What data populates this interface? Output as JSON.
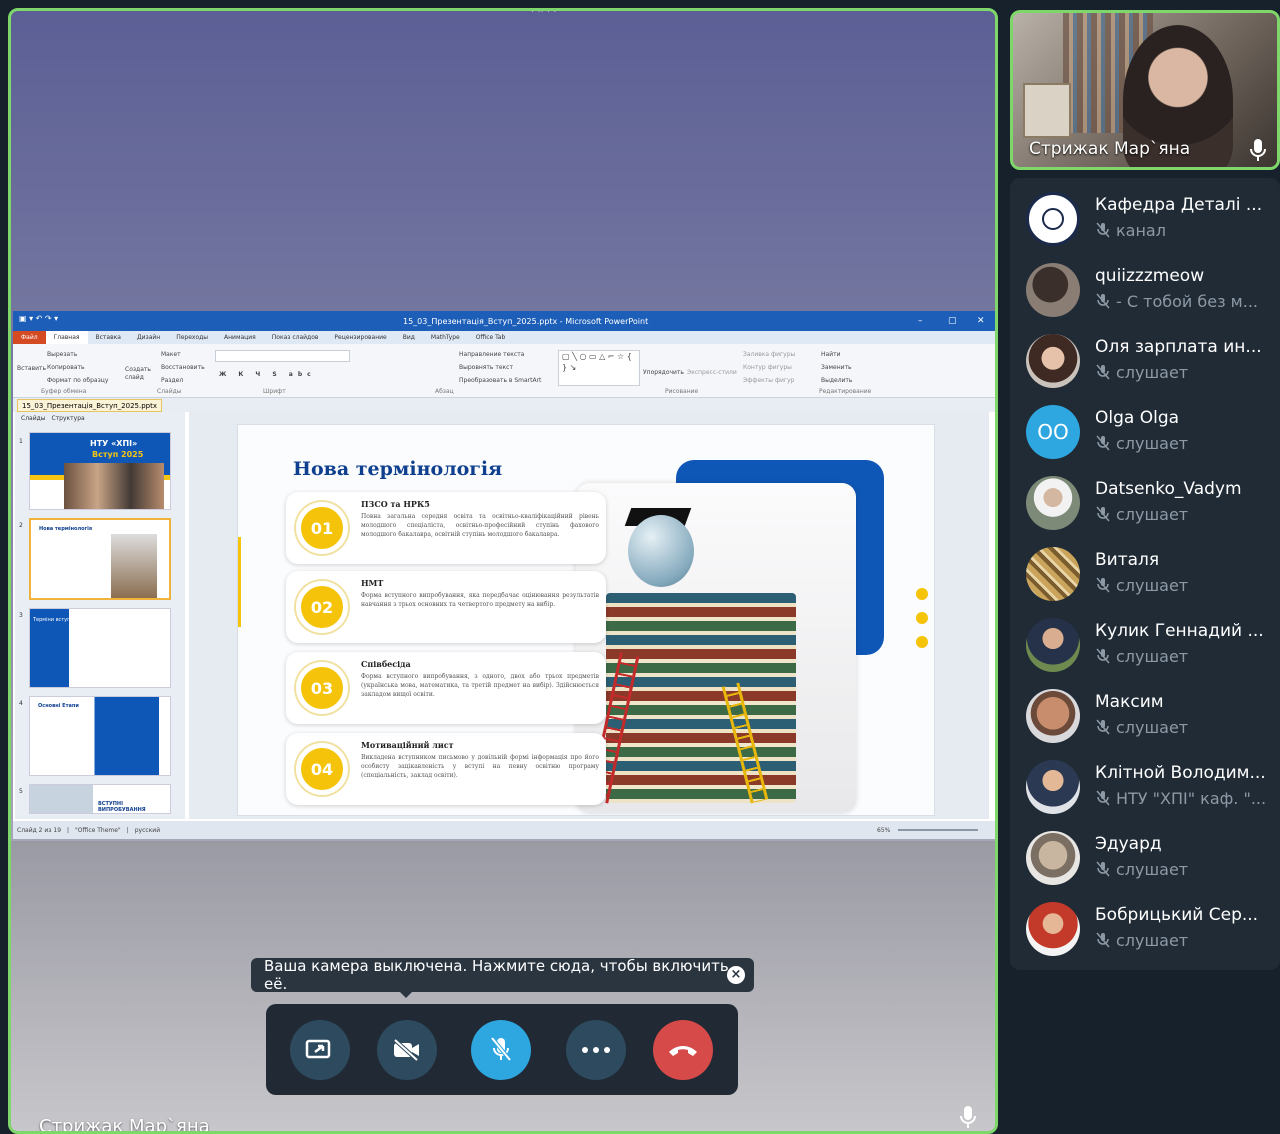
{
  "stage": {
    "speaker_name": "Стрижак Мар`яна"
  },
  "selfcam": {
    "name": "Стрижак Мар`яна"
  },
  "ppt": {
    "window_title": "15_03_Презентація_Вступ_2025.pptx - Microsoft PowerPoint",
    "tabs": [
      "Файл",
      "Главная",
      "Вставка",
      "Дизайн",
      "Переходы",
      "Анимация",
      "Показ слайдов",
      "Рецензирование",
      "Вид",
      "MathType",
      "Office Tab"
    ],
    "ribbon": {
      "clipboard": [
        "Вырезать",
        "Копировать",
        "Формат по образцу"
      ],
      "paste": "Вставить",
      "clipboard_label": "Буфер обмена",
      "slides": [
        "Макет",
        "Восстановить",
        "Раздел"
      ],
      "create_slide": "Создать слайд",
      "slides_label": "Слайды",
      "font_label": "Шрифт",
      "paragraph": [
        "Направление текста",
        "Выровнять текст",
        "Преобразовать в SmartArt"
      ],
      "paragraph_label": "Абзац",
      "arrange": "Упорядочить",
      "quick_styles": "Экспресс-стили",
      "drawing": [
        "Заливка фигуры",
        "Контур фигуры",
        "Эффекты фигур"
      ],
      "drawing_label": "Рисование",
      "editing": [
        "Найти",
        "Заменить",
        "Выделить"
      ],
      "editing_label": "Редактирование"
    },
    "file_tab": "15_03_Презентація_Вступ_2025.pptx",
    "pane_tabs": [
      "Слайды",
      "Структура"
    ],
    "thumb1": {
      "title": "НТУ «ХПІ»",
      "subtitle": "Вступ 2025"
    },
    "thumb2_title": "Нова термінологія",
    "thumb3_title": "Терміни вступу",
    "thumb4_title": "Основні Етапи",
    "thumb5_title": "ВСТУПНІ ВИПРОБУВАННЯ",
    "status": {
      "slide": "Слайд 2 из 19",
      "theme": "\"Office Theme\"",
      "lang": "русский",
      "zoom": "65%"
    },
    "slide": {
      "title": "Нова термінологія",
      "items": [
        {
          "num": "01",
          "name": "ПЗСО та НРК5",
          "desc": "Повна загальна середня освіта та освітньо-кваліфікаційний рівень молодшого спеціаліста, освітньо-професійний ступінь фахового молодшого бакалавра, освітній ступінь молодшого бакалавра."
        },
        {
          "num": "02",
          "name": "НМТ",
          "desc": "Форма вступного випробування, яка передбачає оцінювання результатів навчання з трьох основних та четвертого предмету на вибір."
        },
        {
          "num": "03",
          "name": "Співбесіда",
          "desc": "Форма вступного випробування, з одного, двох або трьох предметів (українська мова, математика, та третій предмет на вибір). Здійснюється закладом вищої освіти."
        },
        {
          "num": "04",
          "name": "Мотиваційний лист",
          "desc": "Викладена вступником письмово у довільній формі інформація про його особисту зацікавленість у вступі на певну освітню програму (спеціальність, заклад освіти)."
        }
      ]
    }
  },
  "participants": [
    {
      "name": "Кафедра Деталі ...",
      "status": "канал",
      "avatar_color": "#ffffff",
      "initials": ""
    },
    {
      "name": "quiizzzmeow",
      "status": "- С тобой без м...",
      "avatar_color": "#2f2a28",
      "initials": ""
    },
    {
      "name": "Оля зарплата ин...",
      "status": "слушает",
      "avatar_color": "#6b4a3a",
      "initials": ""
    },
    {
      "name": "Olga Olga",
      "status": "слушает",
      "avatar_color": "#2ea6df",
      "initials": "OO"
    },
    {
      "name": "Datsenko_Vadym",
      "status": "слушает",
      "avatar_color": "#8a9db0",
      "initials": ""
    },
    {
      "name": "Виталя",
      "status": "слушает",
      "avatar_color": "#8f7a4e",
      "initials": ""
    },
    {
      "name": "Кулик Геннадий ...",
      "status": "слушает",
      "avatar_color": "#596a4a",
      "initials": ""
    },
    {
      "name": "Максим",
      "status": "слушает",
      "avatar_color": "#b7876a",
      "initials": ""
    },
    {
      "name": "Клітной Володим...",
      "status": "НТУ \"ХПІ\" каф. \"...",
      "avatar_color": "#4c6b8f",
      "initials": ""
    },
    {
      "name": "Эдуард",
      "status": "слушает",
      "avatar_color": "#a4a4a0",
      "initials": ""
    },
    {
      "name": "Бобрицький Сер...",
      "status": "слушает",
      "avatar_color": "#4d80b5",
      "initials": ""
    }
  ],
  "tooltip": {
    "text": "Ваша камера выключена. Нажмите сюда, чтобы включить её."
  },
  "controls": {
    "icons": [
      "screen-share-icon",
      "camera-off-icon",
      "mic-muted-icon",
      "more-icon",
      "end-call-icon"
    ],
    "colors": {
      "screen": "#2d4a5f",
      "camera": "#2d4a5f",
      "mic": "#2ea6df",
      "more": "#2d4a5f",
      "end": "#d64a4a"
    }
  }
}
